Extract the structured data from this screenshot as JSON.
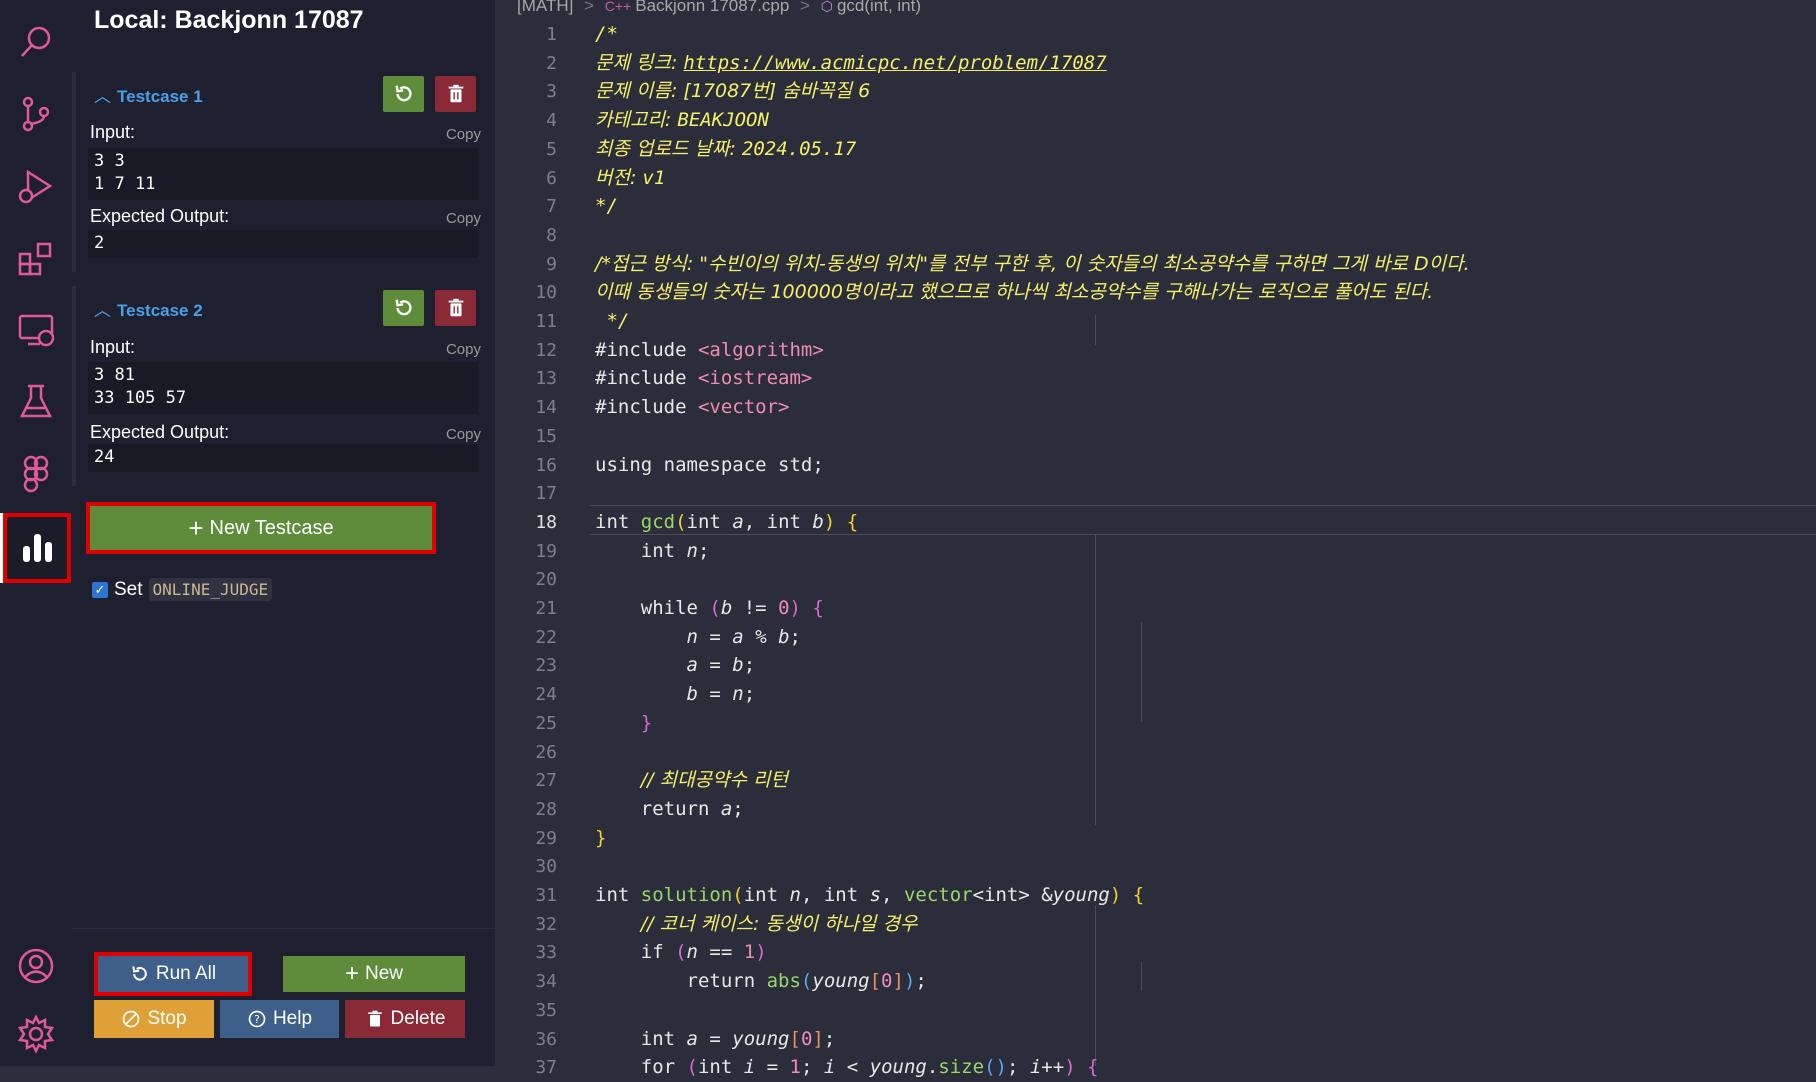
{
  "sidebar": {
    "title": "Local: Backjonn 17087",
    "testcases": [
      {
        "header": "Testcase 1",
        "input_label": "Input:",
        "input_copy": "Copy",
        "input_value": "3 3\n1 7 11",
        "output_label": "Expected Output:",
        "output_copy": "Copy",
        "output_value": "2"
      },
      {
        "header": "Testcase 2",
        "input_label": "Input:",
        "input_copy": "Copy",
        "input_value": "3 81\n33 105 57",
        "output_label": "Expected Output:",
        "output_copy": "Copy",
        "output_value": "24"
      }
    ],
    "new_testcase_label": "New Testcase",
    "set_label": "Set",
    "online_judge": "ONLINE_JUDGE",
    "buttons": {
      "run_all": "Run All",
      "new": "New",
      "stop": "Stop",
      "help": "Help",
      "delete": "Delete"
    }
  },
  "editor": {
    "breadcrumb": {
      "folder": "[MATH]",
      "file": "Backjonn 17087.cpp",
      "symbol": "gcd(int, int)"
    },
    "current_line": 18,
    "lines": [
      {
        "n": "1",
        "segs": [
          [
            "cm",
            "/*"
          ]
        ]
      },
      {
        "n": "2",
        "segs": [
          [
            "cm-k",
            "문제 링크: "
          ],
          [
            "cm ul",
            "https://www.acmicpc.net/problem/17087"
          ]
        ]
      },
      {
        "n": "3",
        "segs": [
          [
            "cm-k",
            "문제 이름: [17087번] 숨바꼭질 6"
          ]
        ]
      },
      {
        "n": "4",
        "segs": [
          [
            "cm-k",
            "카테고리: "
          ],
          [
            "cm",
            "BEAKJOON"
          ]
        ]
      },
      {
        "n": "5",
        "segs": [
          [
            "cm-k",
            "최종 업로드 날짜: "
          ],
          [
            "cm",
            "2024.05.17"
          ]
        ]
      },
      {
        "n": "6",
        "segs": [
          [
            "cm-k",
            "버전: "
          ],
          [
            "cm",
            "v1"
          ]
        ]
      },
      {
        "n": "7",
        "segs": [
          [
            "cm",
            "*/"
          ]
        ]
      },
      {
        "n": "8",
        "segs": []
      },
      {
        "n": "9",
        "segs": [
          [
            "cm-k",
            "/*접근 방식: \"수빈이의 위치-동생의 위치\"를 전부 구한 후, 이 숫자들의 최소공약수를 구하면 그게 바로 D이다."
          ]
        ]
      },
      {
        "n": "10",
        "segs": [
          [
            "cm-k",
            "이때 동생들의 숫자는 100000명이라고 했으므로 하나씩 최소공약수를 구해나가는 로직으로 풀어도 된다."
          ]
        ]
      },
      {
        "n": "11",
        "segs": [
          [
            "cm",
            " */"
          ]
        ]
      },
      {
        "n": "12",
        "segs": [
          [
            "kw",
            "#include "
          ],
          [
            "str",
            "<algorithm>"
          ]
        ]
      },
      {
        "n": "13",
        "segs": [
          [
            "kw",
            "#include "
          ],
          [
            "str",
            "<iostream>"
          ]
        ]
      },
      {
        "n": "14",
        "segs": [
          [
            "kw",
            "#include "
          ],
          [
            "str",
            "<vector>"
          ]
        ]
      },
      {
        "n": "15",
        "segs": []
      },
      {
        "n": "16",
        "segs": [
          [
            "kw",
            "using namespace std;"
          ]
        ]
      },
      {
        "n": "17",
        "segs": []
      },
      {
        "n": "18",
        "segs": [
          [
            "kw",
            "int "
          ],
          [
            "fn",
            "gcd"
          ],
          [
            "br1",
            "("
          ],
          [
            "kw",
            "int "
          ],
          [
            "pv",
            "a"
          ],
          [
            "kw",
            ", int "
          ],
          [
            "pv",
            "b"
          ],
          [
            "br1",
            ")"
          ],
          [
            "kw",
            " "
          ],
          [
            "br1",
            "{"
          ]
        ]
      },
      {
        "n": "19",
        "segs": [
          [
            "kw",
            "    int "
          ],
          [
            "pv",
            "n"
          ],
          [
            "kw",
            ";"
          ]
        ]
      },
      {
        "n": "20",
        "segs": []
      },
      {
        "n": "21",
        "segs": [
          [
            "kw",
            "    while "
          ],
          [
            "br2",
            "("
          ],
          [
            "pv",
            "b"
          ],
          [
            "kw",
            " != "
          ],
          [
            "num",
            "0"
          ],
          [
            "br2",
            ")"
          ],
          [
            "kw",
            " "
          ],
          [
            "br2",
            "{"
          ]
        ]
      },
      {
        "n": "22",
        "segs": [
          [
            "kw",
            "        "
          ],
          [
            "pv",
            "n"
          ],
          [
            "kw",
            " = "
          ],
          [
            "pv",
            "a"
          ],
          [
            "kw",
            " % "
          ],
          [
            "pv",
            "b"
          ],
          [
            "kw",
            ";"
          ]
        ]
      },
      {
        "n": "23",
        "segs": [
          [
            "kw",
            "        "
          ],
          [
            "pv",
            "a"
          ],
          [
            "kw",
            " = "
          ],
          [
            "pv",
            "b"
          ],
          [
            "kw",
            ";"
          ]
        ]
      },
      {
        "n": "24",
        "segs": [
          [
            "kw",
            "        "
          ],
          [
            "pv",
            "b"
          ],
          [
            "kw",
            " = "
          ],
          [
            "pv",
            "n"
          ],
          [
            "kw",
            ";"
          ]
        ]
      },
      {
        "n": "25",
        "segs": [
          [
            "kw",
            "    "
          ],
          [
            "br2",
            "}"
          ]
        ]
      },
      {
        "n": "26",
        "segs": []
      },
      {
        "n": "27",
        "segs": [
          [
            "kw",
            "    "
          ],
          [
            "cm-k",
            "// 최대공약수 리턴"
          ]
        ]
      },
      {
        "n": "28",
        "segs": [
          [
            "kw",
            "    return "
          ],
          [
            "pv",
            "a"
          ],
          [
            "kw",
            ";"
          ]
        ]
      },
      {
        "n": "29",
        "segs": [
          [
            "br1",
            "}"
          ]
        ]
      },
      {
        "n": "30",
        "segs": []
      },
      {
        "n": "31",
        "segs": [
          [
            "kw",
            "int "
          ],
          [
            "fn",
            "solution"
          ],
          [
            "br1",
            "("
          ],
          [
            "kw",
            "int "
          ],
          [
            "pv",
            "n"
          ],
          [
            "kw",
            ", int "
          ],
          [
            "pv",
            "s"
          ],
          [
            "kw",
            ", "
          ],
          [
            "fn",
            "vector"
          ],
          [
            "kw",
            "<int> &"
          ],
          [
            "pv",
            "young"
          ],
          [
            "br1",
            ")"
          ],
          [
            "kw",
            " "
          ],
          [
            "br1",
            "{"
          ]
        ]
      },
      {
        "n": "32",
        "segs": [
          [
            "kw",
            "    "
          ],
          [
            "cm-k",
            "// 코너 케이스: 동생이 하나일 경우"
          ]
        ]
      },
      {
        "n": "33",
        "segs": [
          [
            "kw",
            "    if "
          ],
          [
            "br2",
            "("
          ],
          [
            "pv",
            "n"
          ],
          [
            "kw",
            " == "
          ],
          [
            "num",
            "1"
          ],
          [
            "br2",
            ")"
          ]
        ]
      },
      {
        "n": "34",
        "segs": [
          [
            "kw",
            "        return "
          ],
          [
            "fn",
            "abs"
          ],
          [
            "br3",
            "("
          ],
          [
            "pv",
            "young"
          ],
          [
            "tp",
            "["
          ],
          [
            "num",
            "0"
          ],
          [
            "tp",
            "]"
          ],
          [
            "br3",
            ")"
          ],
          [
            "kw",
            ";"
          ]
        ]
      },
      {
        "n": "35",
        "segs": []
      },
      {
        "n": "36",
        "segs": [
          [
            "kw",
            "    int "
          ],
          [
            "pv",
            "a"
          ],
          [
            "kw",
            " = "
          ],
          [
            "pv",
            "young"
          ],
          [
            "tp",
            "["
          ],
          [
            "num",
            "0"
          ],
          [
            "tp",
            "]"
          ],
          [
            "kw",
            ";"
          ]
        ]
      },
      {
        "n": "37",
        "segs": [
          [
            "kw",
            "    for "
          ],
          [
            "br2",
            "("
          ],
          [
            "kw",
            "int "
          ],
          [
            "pv",
            "i"
          ],
          [
            "kw",
            " = "
          ],
          [
            "num",
            "1"
          ],
          [
            "kw",
            "; "
          ],
          [
            "pv",
            "i"
          ],
          [
            "kw",
            " < "
          ],
          [
            "pv",
            "young"
          ],
          [
            "kw",
            "."
          ],
          [
            "fn",
            "size"
          ],
          [
            "br3",
            "()"
          ],
          [
            "kw",
            "; "
          ],
          [
            "pv",
            "i"
          ],
          [
            "kw",
            "++"
          ],
          [
            "br2",
            ")"
          ],
          [
            "kw",
            " "
          ],
          [
            "br2",
            "{"
          ]
        ]
      }
    ]
  }
}
